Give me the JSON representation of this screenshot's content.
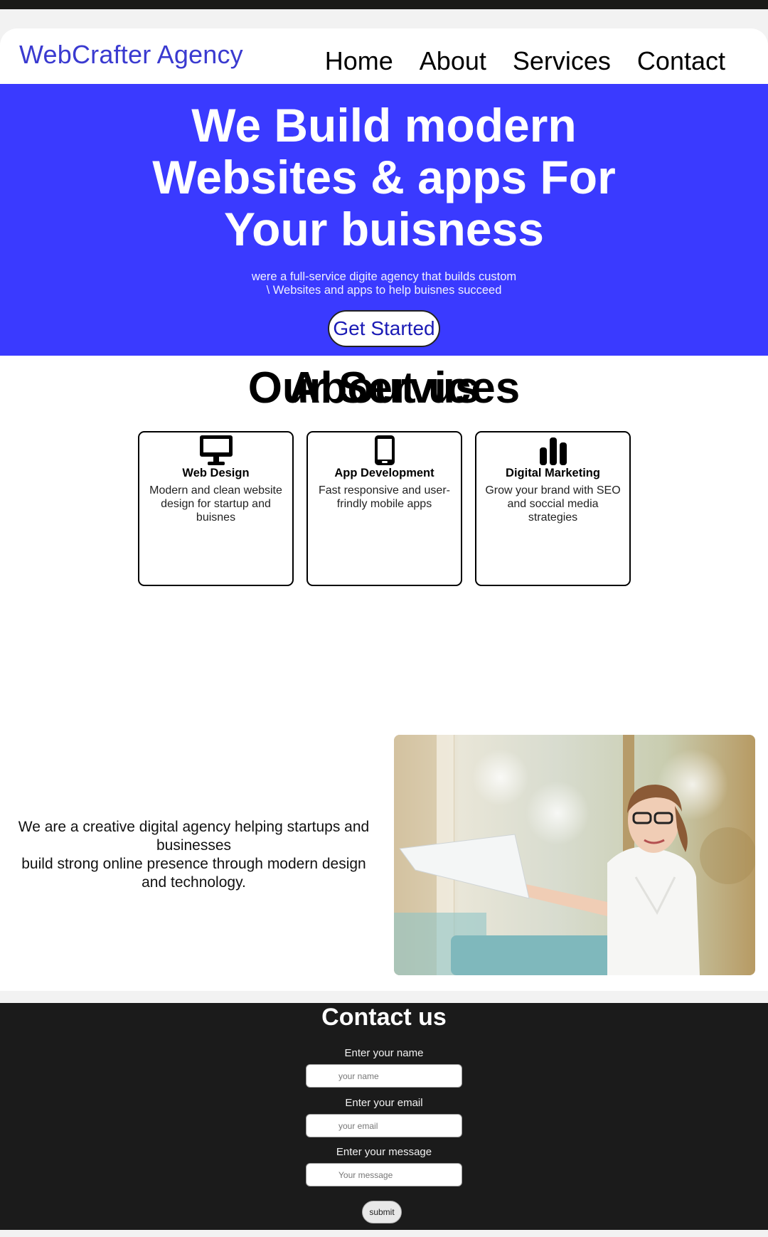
{
  "header": {
    "logo": "WebCrafter Agency",
    "nav": [
      "Home",
      "About",
      "Services",
      "Contact"
    ]
  },
  "hero": {
    "title": "We Build modern Websites & apps For Your buisness",
    "subtitle_line1": "were a full-service digite agency that builds custom",
    "subtitle_line2": "\\ Websites and apps to help buisnes succeed",
    "cta": "Get Started"
  },
  "services": {
    "heading": "Our Services",
    "cards": [
      {
        "icon": "monitor-icon",
        "title": "Web Design",
        "desc": "Modern and clean website design for startup and buisnes"
      },
      {
        "icon": "smartphone-icon",
        "title": "App Development",
        "desc": "Fast responsive and user-frindly mobile apps"
      },
      {
        "icon": "bar-chart-icon",
        "title": "Digital Marketing",
        "desc": "Grow your brand with SEO and soccial media strategies"
      }
    ]
  },
  "about": {
    "heading": "About us",
    "text_line1": "We are a creative digital agency helping startups and businesses",
    "text_line2": "build strong online presence through modern design and technology."
  },
  "contact": {
    "heading": "Contact us",
    "name_label": "Enter your name",
    "name_placeholder": "your name",
    "email_label": "Enter your email",
    "email_placeholder": "your email",
    "message_label": "Enter your message",
    "message_placeholder": "Your message",
    "submit": "submit"
  },
  "colors": {
    "brand_blue": "#3a3aff",
    "logo_blue": "#3a3ad0",
    "footer_dark": "#1b1b1b"
  }
}
